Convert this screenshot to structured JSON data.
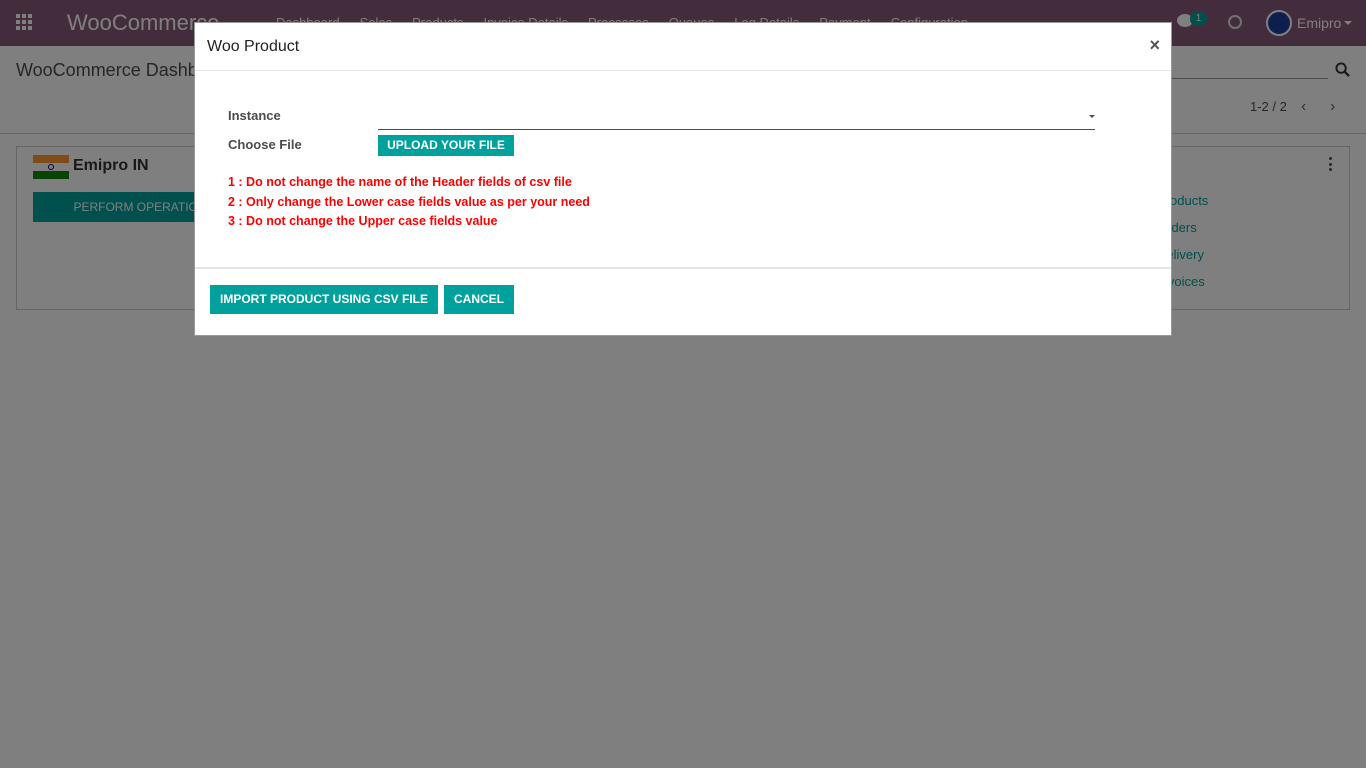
{
  "navbar": {
    "brand": "WooCommerce",
    "menu": [
      "Dashboard",
      "Sales",
      "Products",
      "Invoice Details",
      "Processes",
      "Queues",
      "Log Details",
      "Payment",
      "Configuration"
    ],
    "chat_badge": "1",
    "user_name": "Emipro"
  },
  "control_panel": {
    "title": "WooCommerce Dashboard",
    "pager": "1-2 / 2"
  },
  "card": {
    "name": "Emipro IN",
    "perform_label": "PERFORM OPERATION",
    "links": [
      "Products",
      "Orders",
      "Delivery",
      "Invoices"
    ]
  },
  "modal": {
    "title": "Woo Product",
    "close": "×",
    "instance_label": "Instance",
    "instance_value": "",
    "choose_file_label": "Choose File",
    "upload_label": "UPLOAD YOUR FILE",
    "notes": [
      "1 : Do not change the name of the Header fields of csv file",
      "2 : Only change the Lower case fields value as per your need",
      "3 : Do not change the Upper case fields value"
    ],
    "import_label": "IMPORT PRODUCT USING CSV FILE",
    "cancel_label": "CANCEL"
  },
  "colors": {
    "navbar": "#875a7b",
    "primary": "#00a09d",
    "warning_text": "#ff0000"
  }
}
